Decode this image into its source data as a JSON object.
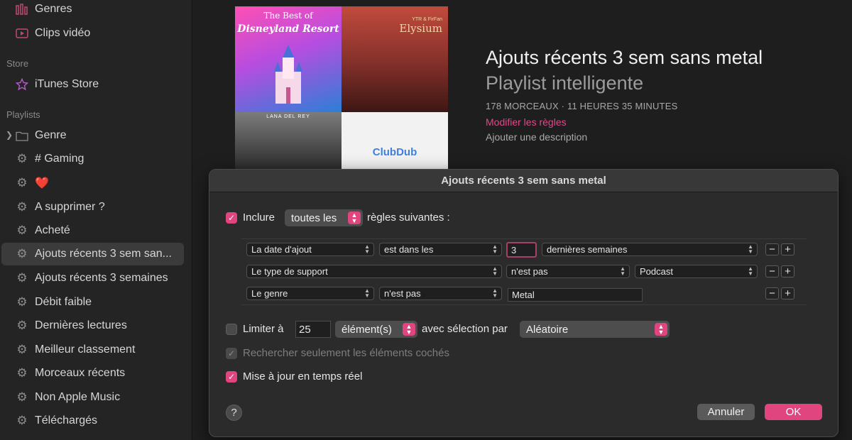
{
  "sidebar": {
    "top_items": [
      {
        "label": "Genres",
        "icon": "genres-icon"
      },
      {
        "label": "Clips vidéo",
        "icon": "video-clips-icon"
      }
    ],
    "store_header": "Store",
    "store_items": [
      {
        "label": "iTunes Store",
        "icon": "star-icon"
      }
    ],
    "playlists_header": "Playlists",
    "playlist_items": [
      {
        "label": "Genre",
        "icon": "folder-icon"
      },
      {
        "label": "# Gaming",
        "icon": "gear-icon"
      },
      {
        "label": "❤️",
        "icon": "gear-icon"
      },
      {
        "label": "A supprimer ?",
        "icon": "gear-icon"
      },
      {
        "label": "Acheté",
        "icon": "gear-icon"
      },
      {
        "label": "Ajouts récents 3 sem san...",
        "icon": "gear-icon",
        "selected": true
      },
      {
        "label": "Ajouts récents 3 semaines",
        "icon": "gear-icon"
      },
      {
        "label": "Débit faible",
        "icon": "gear-icon"
      },
      {
        "label": "Dernières lectures",
        "icon": "gear-icon"
      },
      {
        "label": "Meilleur classement",
        "icon": "gear-icon"
      },
      {
        "label": "Morceaux récents",
        "icon": "gear-icon"
      },
      {
        "label": "Non Apple Music",
        "icon": "gear-icon"
      },
      {
        "label": "Téléchargés",
        "icon": "gear-icon"
      }
    ]
  },
  "playlist": {
    "title": "Ajouts récents 3 sem sans metal",
    "subtitle": "Playlist intelligente",
    "meta": "178 MORCEAUX · 11 HEURES 35 MINUTES",
    "edit_rules_link": "Modifier les règles",
    "add_description": "Ajouter une description",
    "artwork": {
      "tile1_line1": "The Best of",
      "tile1_line2": "Disneyland Resort",
      "tile2_line1": "YTR & FirFan",
      "tile2_line2": "Elysium",
      "tile3_line1": "LANA DEL REY",
      "tile4_line1": "ClubDub"
    }
  },
  "dialog": {
    "title": "Ajouts récents 3 sem sans metal",
    "include_label": "Inclure",
    "include_checked": true,
    "match_popup": "toutes les",
    "match_suffix": "règles suivantes :",
    "rules": [
      {
        "field": "La date d'ajout",
        "operator": "est dans les",
        "value": "3",
        "unit": "dernières semaines"
      },
      {
        "field": "Le type de support",
        "operator": "n'est pas",
        "value": "Podcast"
      },
      {
        "field": "Le genre",
        "operator": "n'est pas",
        "value": "Metal"
      }
    ],
    "remove_symbol": "−",
    "add_symbol": "+",
    "limit_label": "Limiter à",
    "limit_checked": false,
    "limit_value": "25",
    "limit_unit": "élément(s)",
    "selection_label": "avec sélection par",
    "selection_value": "Aléatoire",
    "checked_only_label": "Rechercher seulement les éléments cochés",
    "checked_only_checked": true,
    "live_update_label": "Mise à jour en temps réel",
    "live_update_checked": true,
    "help_symbol": "?",
    "cancel_label": "Annuler",
    "ok_label": "OK"
  },
  "colors": {
    "accent": "#e0457f",
    "sidebar_bg": "#242424",
    "dialog_bg": "#2b2b2b"
  }
}
